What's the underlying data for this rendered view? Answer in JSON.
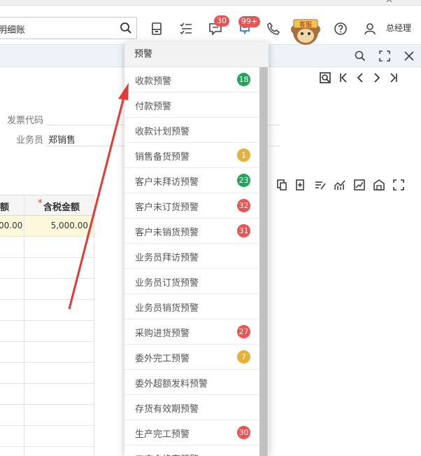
{
  "header": {
    "search_value": "明细账",
    "badges": {
      "messages": "30",
      "alerts": "99+"
    },
    "service_label": "客服",
    "user_name": "总经理"
  },
  "form": {
    "invoice_code_label": "发票代码",
    "salesperson_label": "业务员",
    "salesperson_value": "郑销售"
  },
  "grid": {
    "col1_header": "额",
    "col2_required_mark": "*",
    "col2_header": "含税金额",
    "first_row": {
      "col1": "00.00",
      "col2": "5,000.00"
    }
  },
  "dropdown": {
    "title": "预警",
    "items": [
      {
        "label": "收款预警",
        "count": "18",
        "color": "#21a35a"
      },
      {
        "label": "付款预警",
        "count": "",
        "color": ""
      },
      {
        "label": "收款计划预警",
        "count": "",
        "color": ""
      },
      {
        "label": "销售备货预警",
        "count": "1",
        "color": "#e3b23c"
      },
      {
        "label": "客户未拜访预警",
        "count": "23",
        "color": "#21a35a"
      },
      {
        "label": "客户未订货预警",
        "count": "32",
        "color": "#e95454"
      },
      {
        "label": "客户未销货预警",
        "count": "31",
        "color": "#e95454"
      },
      {
        "label": "业务员拜访预警",
        "count": "",
        "color": ""
      },
      {
        "label": "业务员订货预警",
        "count": "",
        "color": ""
      },
      {
        "label": "业务员销货预警",
        "count": "",
        "color": ""
      },
      {
        "label": "采购进货预警",
        "count": "27",
        "color": "#e95454"
      },
      {
        "label": "委外完工预警",
        "count": "7",
        "color": "#e3b23c"
      },
      {
        "label": "委外超额发料预警",
        "count": "",
        "color": ""
      },
      {
        "label": "存货有效期预警",
        "count": "",
        "color": ""
      },
      {
        "label": "生产完工预警",
        "count": "30",
        "color": "#e95454"
      },
      {
        "label": "工序合格率预警",
        "count": "",
        "color": ""
      }
    ]
  },
  "colors": {
    "accent": "#2f7de1",
    "annotation": "#e53935"
  }
}
